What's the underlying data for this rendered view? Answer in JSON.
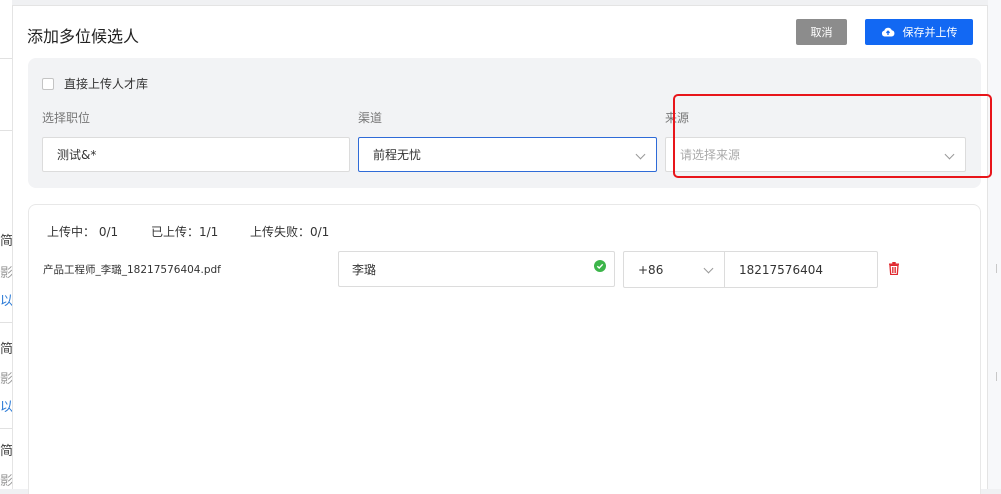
{
  "modal": {
    "title": "添加多位候选人",
    "cancel_label": "取消",
    "save_label": "保存并上传"
  },
  "config": {
    "direct_upload_label": "直接上传人才库",
    "direct_upload_checked": false,
    "position": {
      "label": "选择职位",
      "value": "测试&*"
    },
    "channel": {
      "label": "渠道",
      "value": "前程无忧"
    },
    "source": {
      "label": "来源",
      "placeholder": "请选择来源"
    }
  },
  "upload": {
    "uploading": "上传中： 0/1",
    "uploaded": "已上传：1/1",
    "failed": "上传失败：0/1",
    "files": [
      {
        "file_name": "产品工程师_李璐_18217576404.pdf",
        "candidate_name": "李璐",
        "country_code": "+86",
        "phone": "18217576404"
      }
    ]
  },
  "background": {
    "fragments": [
      "简",
      "影",
      "以",
      "简",
      "影",
      "以",
      "简",
      "影"
    ]
  },
  "colors": {
    "primary": "#1268f3",
    "cancel": "#8c8c8c",
    "highlight": "#e8151a",
    "success": "#3cb54a",
    "danger": "#e0282e"
  },
  "icons": [
    "cloud-upload-icon",
    "check-circle-icon",
    "trash-icon",
    "chevron-down-icon"
  ]
}
